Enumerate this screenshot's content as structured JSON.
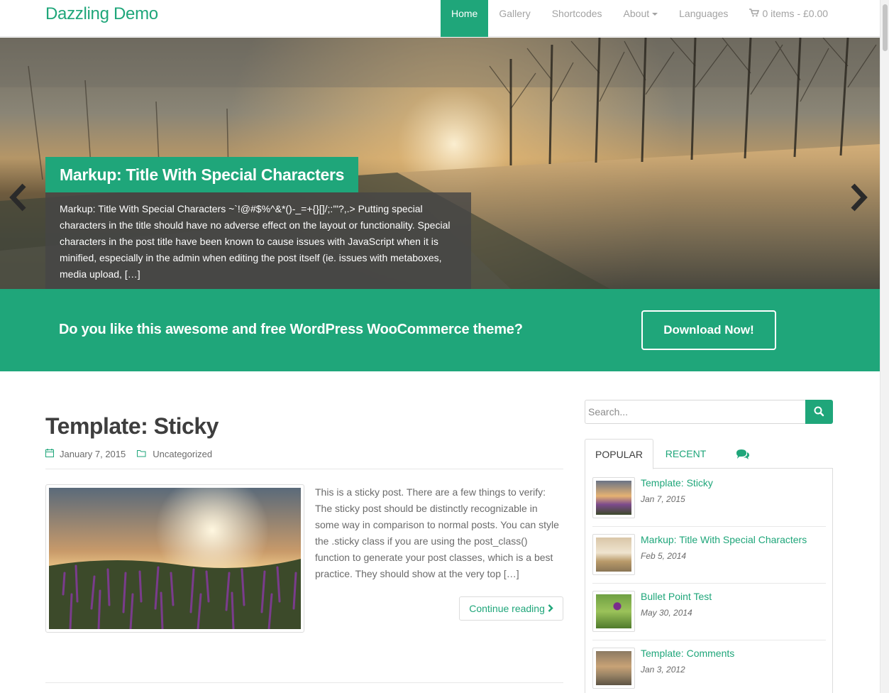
{
  "site": {
    "brand": "Dazzling Demo"
  },
  "nav": {
    "items": [
      {
        "label": "Home"
      },
      {
        "label": "Gallery"
      },
      {
        "label": "Shortcodes"
      },
      {
        "label": "About"
      },
      {
        "label": "Languages"
      }
    ],
    "cart_label": "0 items - £0.00"
  },
  "slider": {
    "title": "Markup: Title With Special Characters",
    "excerpt": "Markup: Title With Special Characters ~`!@#$%^&*()-_=+{}[]/;:'\"?,.> Putting special characters in the title should have no adverse effect on the layout or functionality. Special characters in the post title have been known to cause issues with JavaScript when it is minified, especially in the admin when editing the post itself (ie. issues with metaboxes, media upload, […]",
    "prev_icon": "chevron-left-icon",
    "next_icon": "chevron-right-icon"
  },
  "cta": {
    "text": "Do you like this awesome and free WordPress WooCommerce theme?",
    "button": "Download Now!"
  },
  "post": {
    "title": "Template: Sticky",
    "date": "January 7, 2015",
    "category": "Uncategorized",
    "excerpt": "This is a sticky post. There are a few things to verify: The sticky post should be distinctly recognizable in some way in comparison to normal posts. You can style the .sticky class if you are using the post_class() function to generate your post classes, which is a best practice. They should show at the very top […]",
    "continue_label": "Continue reading"
  },
  "sidebar": {
    "search_placeholder": "Search...",
    "tabs": {
      "popular": "POPULAR",
      "recent": "RECENT"
    },
    "popular": [
      {
        "title": "Template: Sticky",
        "date": "Jan 7, 2015"
      },
      {
        "title": "Markup: Title With Special Characters",
        "date": "Feb 5, 2014"
      },
      {
        "title": "Bullet Point Test",
        "date": "May 30, 2014"
      },
      {
        "title": "Template: Comments",
        "date": "Jan 3, 2012"
      }
    ]
  },
  "colors": {
    "accent": "#1fa67a",
    "text": "#6b6b6b",
    "heading": "#3e3e3e"
  }
}
